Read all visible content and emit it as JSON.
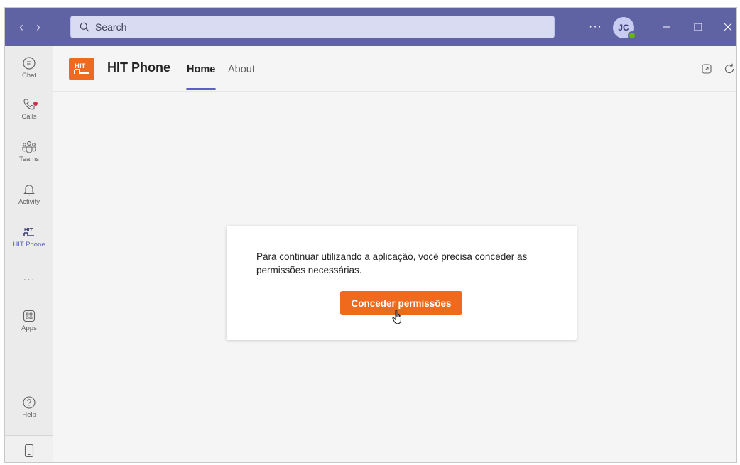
{
  "titlebar": {
    "back_icon": "chevron-left-icon",
    "forward_icon": "chevron-right-icon",
    "search_placeholder": "Search",
    "more_label": "···",
    "avatar_initials": "JC",
    "presence_color": "#6bb700",
    "accent_color": "#5f62a3"
  },
  "rail": {
    "items": [
      {
        "label": "Chat",
        "icon": "chat-icon"
      },
      {
        "label": "Calls",
        "icon": "calls-icon",
        "has_notification": true
      },
      {
        "label": "Teams",
        "icon": "teams-icon"
      },
      {
        "label": "Activity",
        "icon": "bell-icon"
      },
      {
        "label": "HIT Phone",
        "icon": "hit-phone-icon",
        "active": true
      },
      {
        "label": "···",
        "icon": "more-apps-icon"
      },
      {
        "label": "Apps",
        "icon": "apps-icon"
      },
      {
        "label": "Help",
        "icon": "help-icon"
      }
    ],
    "bottom_icon": "mobile-device-icon"
  },
  "app": {
    "title": "HIT Phone",
    "logo_text": "HIT",
    "logo_color": "#ee6a1f",
    "tabs": [
      {
        "label": "Home",
        "active": true
      },
      {
        "label": "About",
        "active": false
      }
    ],
    "popout_icon": "popout-icon",
    "refresh_icon": "refresh-icon"
  },
  "card": {
    "message": "Para continuar utilizando a aplicação, você precisa conceder as permissões necessárias.",
    "button_label": "Conceder permissões",
    "button_color": "#f06a1e"
  }
}
